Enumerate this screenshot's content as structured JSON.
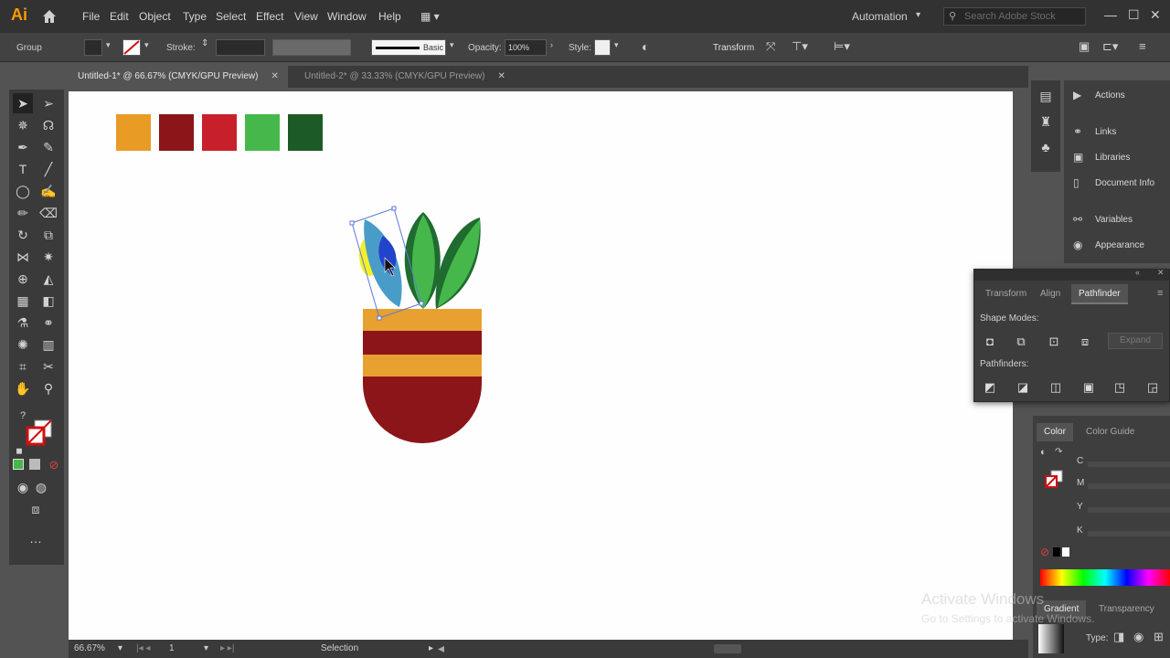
{
  "app": {
    "logo": "Ai"
  },
  "menu": [
    "File",
    "Edit",
    "Object",
    "Type",
    "Select",
    "Effect",
    "View",
    "Window",
    "Help"
  ],
  "workspace": "Automation",
  "search": {
    "placeholder": "Search Adobe Stock"
  },
  "control": {
    "selection_type": "Group",
    "stroke_label": "Stroke:",
    "brush_label": "Basic",
    "opacity_label": "Opacity:",
    "opacity_value": "100%",
    "style_label": "Style:",
    "transform_label": "Transform"
  },
  "tabs": [
    {
      "label": "Untitled-1* @ 66.67% (CMYK/GPU Preview)",
      "active": true
    },
    {
      "label": "Untitled-2* @ 33.33% (CMYK/GPU Preview)",
      "active": false
    }
  ],
  "swatches": [
    "#e89b25",
    "#8b1518",
    "#c8202a",
    "#46b84b",
    "#1c5a28"
  ],
  "artwork": {
    "pot_band_color": "#e8a030",
    "pot_stripe_color": "#8b1518",
    "leaf_dark": "#1f6b30",
    "leaf_light": "#46b84b",
    "selected_leaf": "#4a9cc8"
  },
  "status": {
    "zoom": "66.67%",
    "artboard": "1",
    "tool": "Selection"
  },
  "right_panel": [
    {
      "icon": "play-icon",
      "label": "Actions"
    },
    {
      "icon": "link-icon",
      "label": "Links"
    },
    {
      "icon": "library-icon",
      "label": "Libraries"
    },
    {
      "icon": "document-icon",
      "label": "Document Info"
    },
    {
      "icon": "variables-icon",
      "label": "Variables"
    },
    {
      "icon": "appearance-icon",
      "label": "Appearance"
    }
  ],
  "float_panel": {
    "tabs": [
      "Transform",
      "Align",
      "Pathfinder"
    ],
    "active_tab": "Pathfinder",
    "shape_modes_label": "Shape Modes:",
    "pathfinders_label": "Pathfinders:",
    "expand_label": "Expand"
  },
  "color_panel": {
    "tabs": [
      "Color",
      "Color Guide"
    ],
    "channels": [
      "C",
      "M",
      "Y",
      "K"
    ]
  },
  "gradient_panel": {
    "tabs": [
      "Gradient",
      "Transparency"
    ],
    "type_label": "Type:"
  },
  "watermark": {
    "line1": "Activate Windows",
    "line2": "Go to Settings to activate Windows."
  }
}
